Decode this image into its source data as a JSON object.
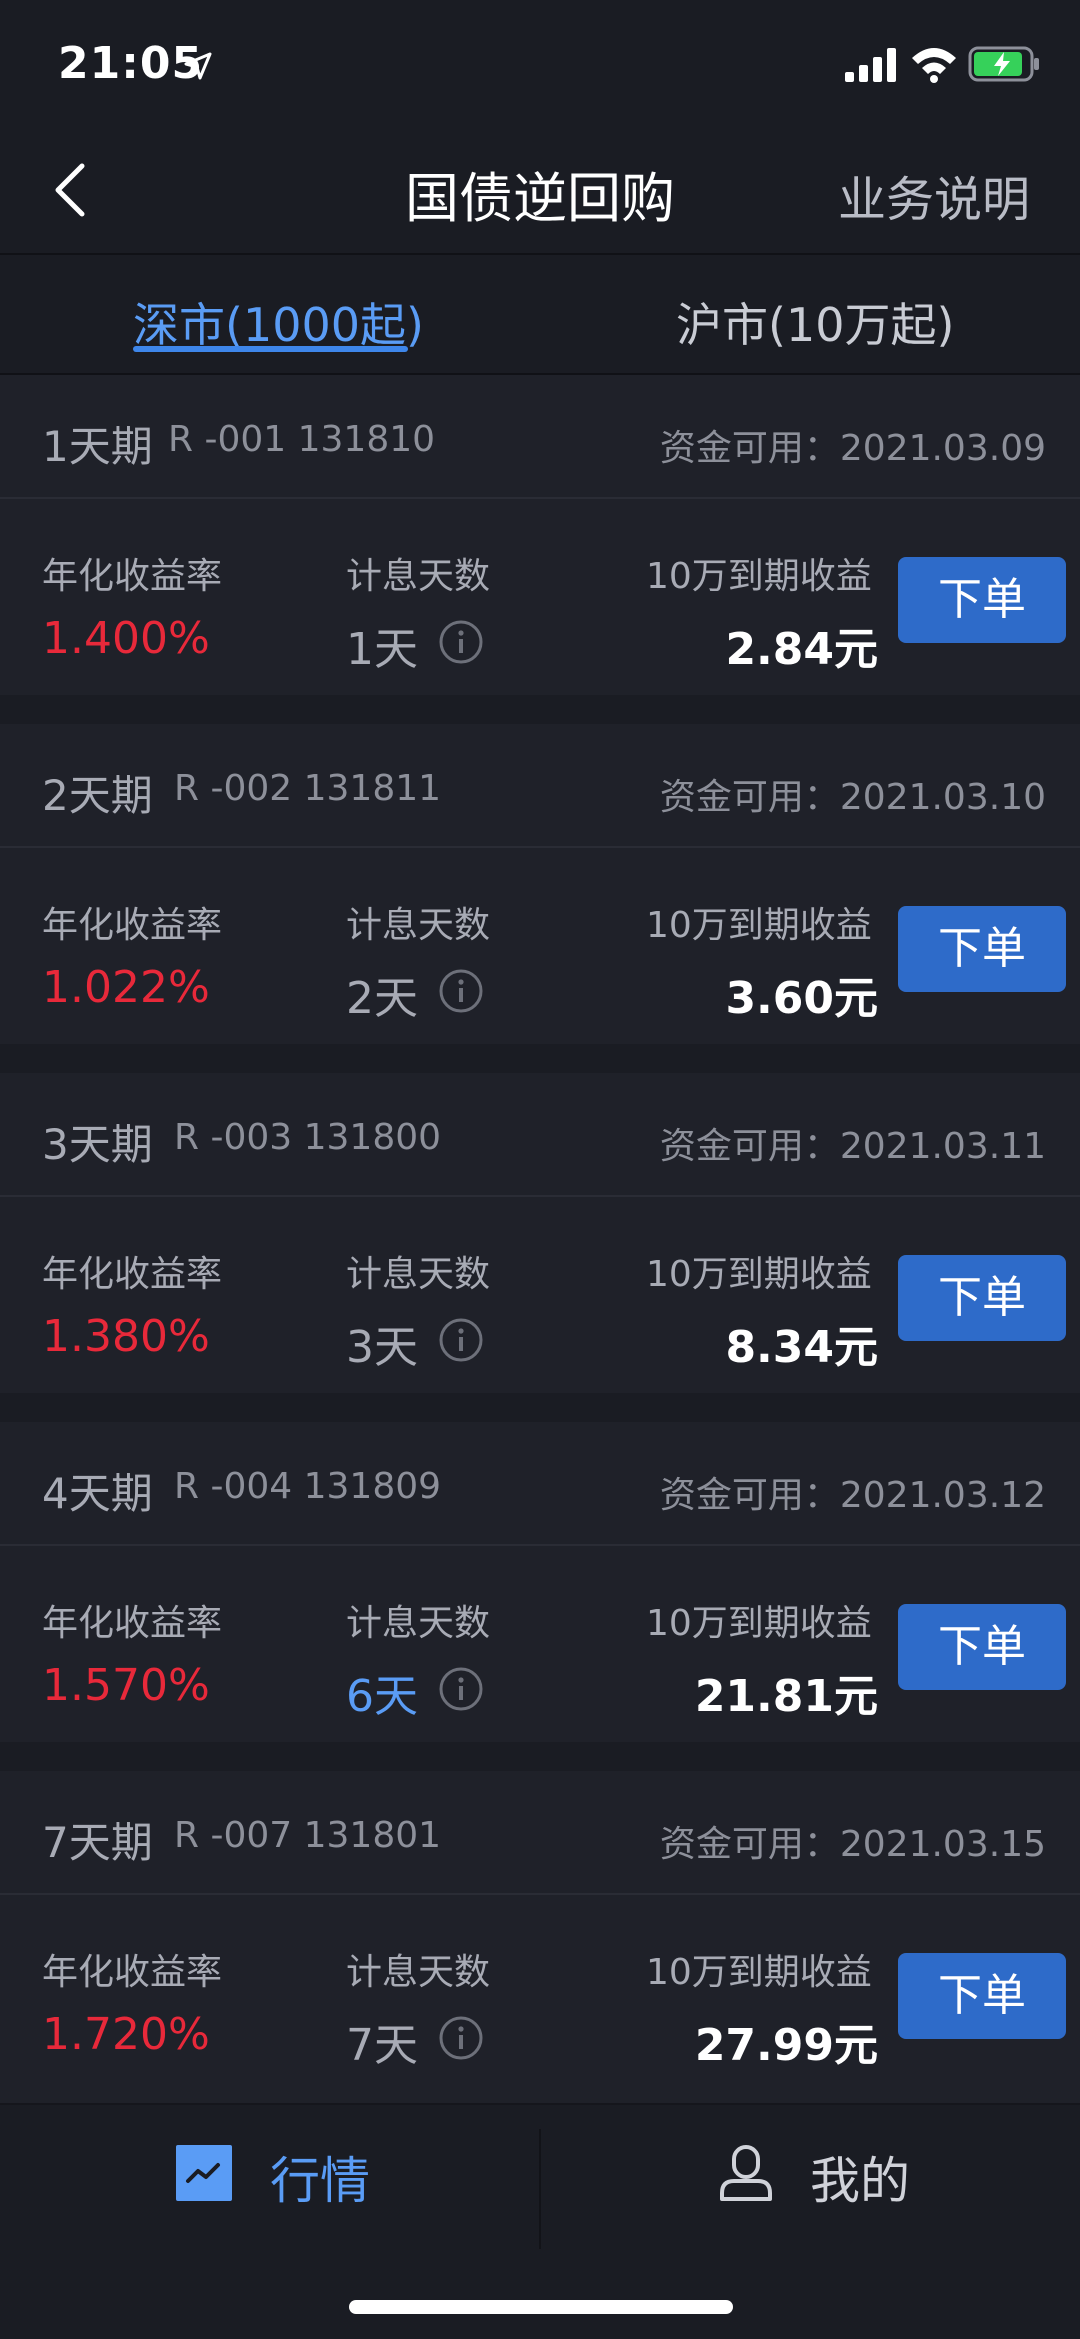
{
  "status_bar": {
    "time": "21:05"
  },
  "nav": {
    "title": "国债逆回购",
    "help_label": "业务说明"
  },
  "tabs": [
    {
      "label": "深市(1000起)",
      "active": true
    },
    {
      "label": "沪市(10万起)",
      "active": false
    }
  ],
  "labels": {
    "rate": "年化收益率",
    "days": "计息天数",
    "income": "10万到期收益",
    "order": "下单"
  },
  "products": [
    {
      "period": "1天期",
      "code": "R -001 131810",
      "avail": "资金可用：2021.03.09",
      "rate": "1.400%",
      "days": "1天",
      "income": "2.84元"
    },
    {
      "period": "2天期",
      "code": "R -002 131811",
      "avail": "资金可用：2021.03.10",
      "rate": "1.022%",
      "days": "2天",
      "income": "3.60元"
    },
    {
      "period": "3天期",
      "code": "R -003 131800",
      "avail": "资金可用：2021.03.11",
      "rate": "1.380%",
      "days": "3天",
      "income": "8.34元"
    },
    {
      "period": "4天期",
      "code": "R -004 131809",
      "avail": "资金可用：2021.03.12",
      "rate": "1.570%",
      "days": "6天",
      "income": "21.81元",
      "days_highlight": true
    },
    {
      "period": "7天期",
      "code": "R -007 131801",
      "avail": "资金可用：2021.03.15",
      "rate": "1.720%",
      "days": "7天",
      "income": "27.99元"
    }
  ],
  "tabbar": {
    "market_label": "行情",
    "mine_label": "我的"
  },
  "colors": {
    "background": "#1a1c23",
    "card": "#1f2129",
    "accent": "#5a9cf5",
    "rate_red": "#e8293a",
    "button": "#2e6bc9"
  }
}
